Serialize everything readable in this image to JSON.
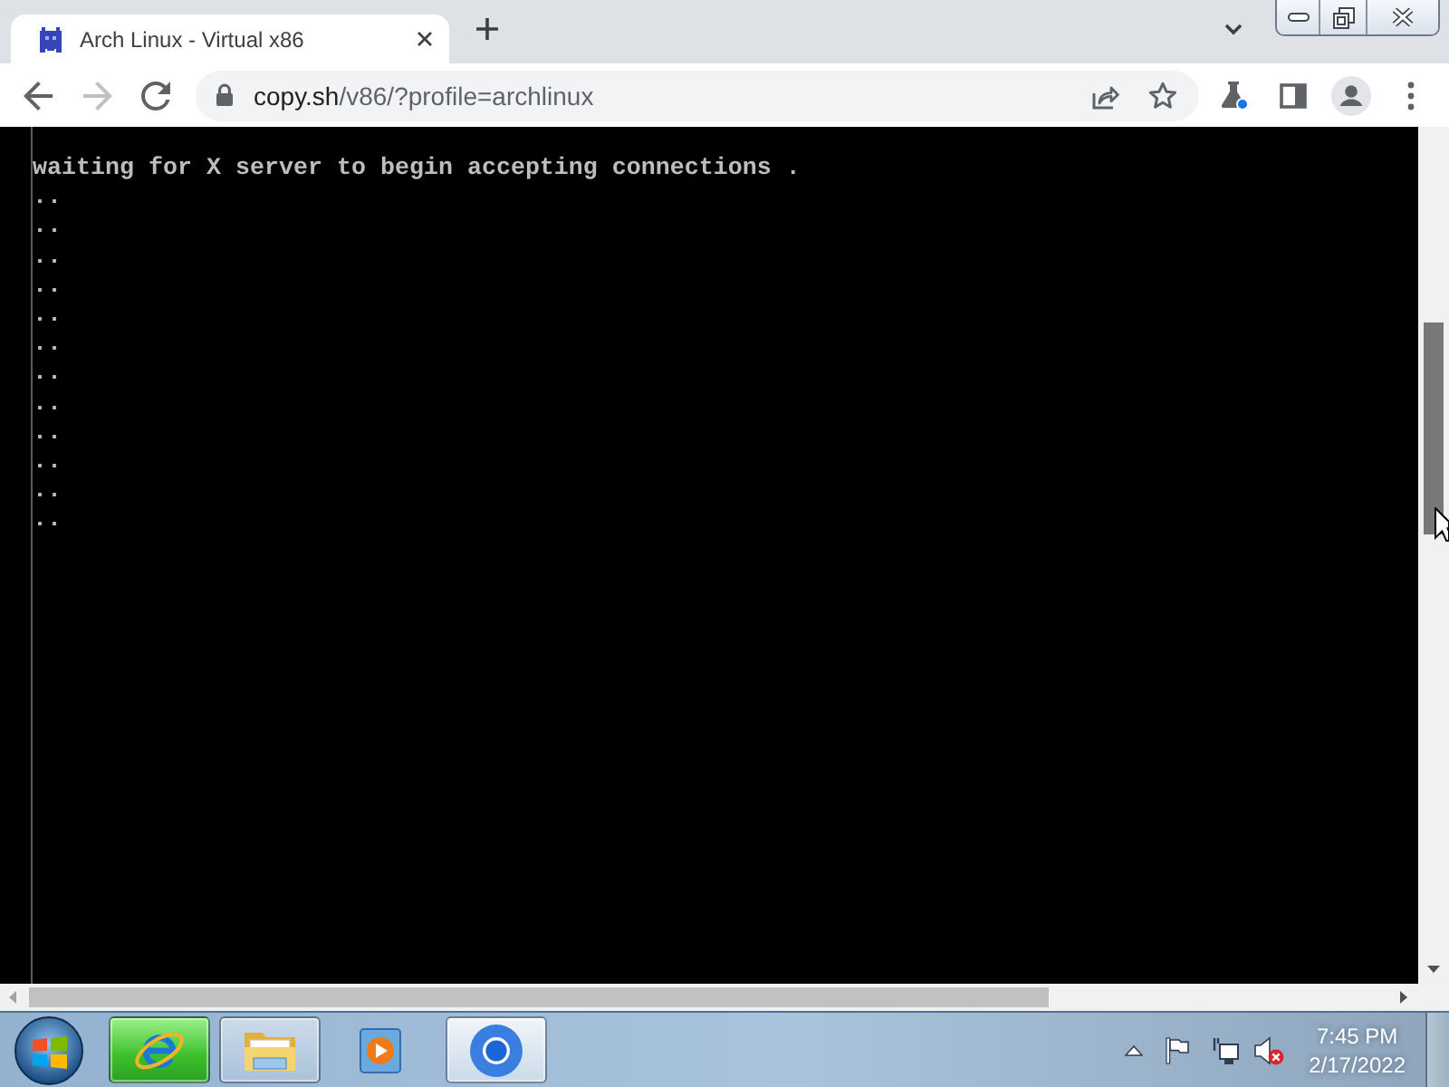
{
  "browser": {
    "tabs": [
      {
        "title": "Arch Linux - Virtual x86",
        "selected": true
      }
    ],
    "navigation": {
      "back": {
        "disabled": false
      },
      "forward": {
        "disabled": true
      }
    },
    "address_bar": {
      "host": "copy.sh",
      "path": "/v86/?profile=archlinux",
      "bookmarked": false
    }
  },
  "terminal": {
    "lines": [
      "waiting for X server to begin accepting connections .",
      "..",
      "..",
      "..",
      "..",
      "..",
      "..",
      "..",
      "..",
      "..",
      "..",
      "..",
      ".."
    ]
  },
  "taskbar": {
    "apps": [
      {
        "kind": "e_browser",
        "running": true,
        "hovered": true,
        "active": false
      },
      {
        "kind": "file_explorer",
        "running": true,
        "hovered": false,
        "active": false
      },
      {
        "kind": "media_player",
        "running": false,
        "hovered": false,
        "active": false
      },
      {
        "kind": "ring_browser",
        "running": true,
        "hovered": false,
        "active": true
      }
    ],
    "tray": {
      "volume_muted": true,
      "time": "7:45 PM",
      "date": "2/17/2022"
    }
  }
}
